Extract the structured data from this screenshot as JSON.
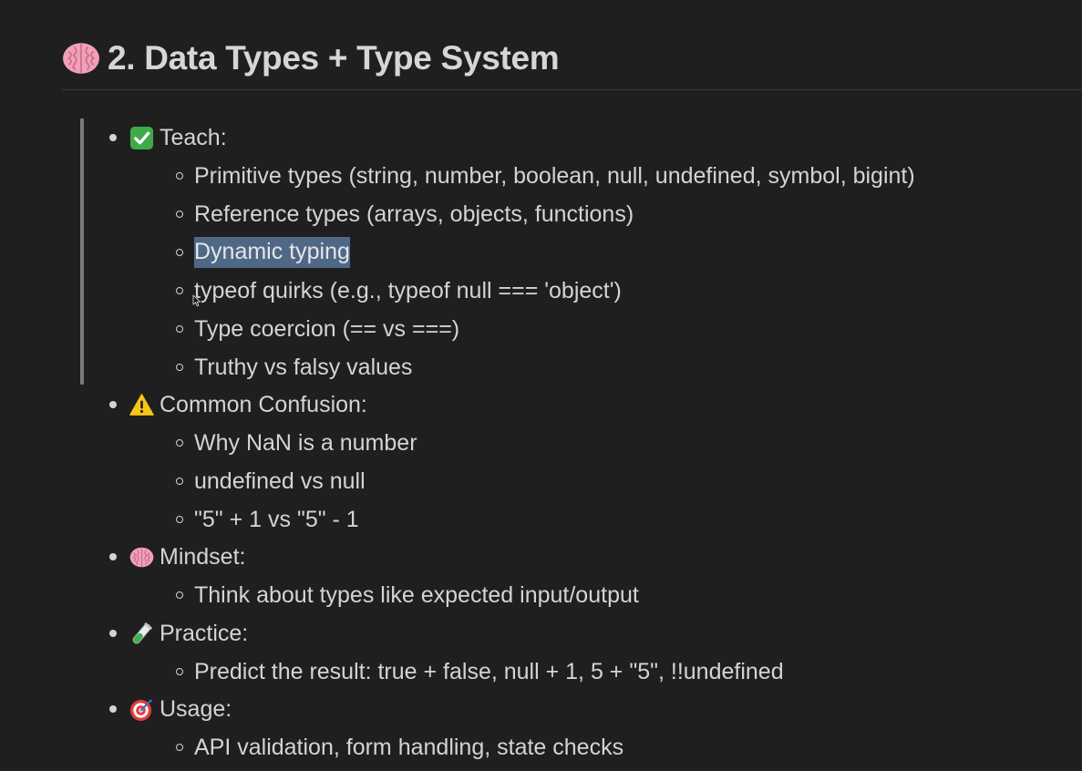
{
  "heading": {
    "text": "2. Data Types + Type System",
    "icon": "brain-icon"
  },
  "sections": [
    {
      "label": "Teach:",
      "icon": "check-mark-icon",
      "items": [
        "Primitive types (string, number, boolean, null, undefined, symbol, bigint)",
        "Reference types (arrays, objects, functions)",
        "Dynamic typing",
        "typeof quirks (e.g., typeof null === 'object')",
        "Type coercion (== vs ===)",
        "Truthy vs falsy values"
      ]
    },
    {
      "label": "Common Confusion:",
      "icon": "warning-icon",
      "items": [
        "Why NaN is a number",
        "undefined vs null",
        "\"5\" + 1 vs \"5\" - 1"
      ]
    },
    {
      "label": "Mindset:",
      "icon": "brain-icon",
      "items": [
        "Think about types like expected input/output"
      ]
    },
    {
      "label": "Practice:",
      "icon": "test-tube-icon",
      "items": [
        "Predict the result: true + false, null + 1, 5 + \"5\", !!undefined"
      ]
    },
    {
      "label": "Usage:",
      "icon": "target-icon",
      "items": [
        "API validation, form handling, state checks"
      ]
    }
  ],
  "colors": {
    "background": "#1f1f1f",
    "text": "#d4d4d4",
    "selection": "#4f6888",
    "active_bar": "#7a7a7a"
  }
}
